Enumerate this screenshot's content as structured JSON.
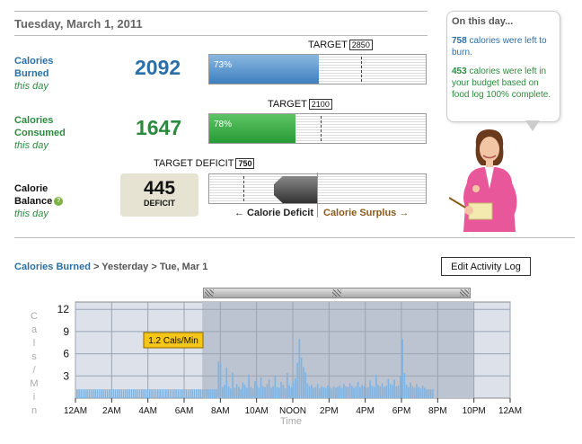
{
  "date": "Tuesday, March 1, 2011",
  "burned": {
    "label_line1": "Calories",
    "label_line2": "Burned",
    "sub": "this day",
    "value": "2092",
    "target_label": "TARGET",
    "target": "2850",
    "percent_label": "73%",
    "percent": 73
  },
  "consumed": {
    "label_line1": "Calories",
    "label_line2": "Consumed",
    "sub": "this day",
    "value": "1647",
    "target_label": "TARGET",
    "target": "2100",
    "percent_label": "78%",
    "percent": 78
  },
  "balance": {
    "label_line1": "Calorie",
    "label_line2": "Balance",
    "sub": "this day",
    "help_icon": "?",
    "value": "445",
    "value_label": "DEFICIT",
    "target_label": "TARGET DEFICIT",
    "target": "750",
    "left_label": "← Calorie Deficit",
    "right_label": "Calorie Surplus →"
  },
  "bubble": {
    "title": "On this day...",
    "line1_num": "758",
    "line1_text": " calories were left to burn.",
    "line2_num": "453",
    "line2_text": " calories were left in your budget based on food log 100% complete."
  },
  "breadcrumb": {
    "link": "Calories Burned",
    "rest": " > Yesterday > Tue, Mar 1"
  },
  "edit_button": "Edit Activity Log",
  "colors": {
    "blue": "#2a6fa8",
    "green": "#2b8a3e",
    "bar_blue": "#3d7fbf",
    "bar_green": "#279a35",
    "tooltip": "#f5c518"
  },
  "chart_data": {
    "type": "bar",
    "ylabel": "Cals/Min",
    "xlabel": "Time",
    "ylim": [
      0,
      13
    ],
    "yticks": [
      3,
      6,
      9,
      12
    ],
    "xticks": [
      "12AM",
      "2AM",
      "4AM",
      "6AM",
      "8AM",
      "10AM",
      "NOON",
      "2PM",
      "4PM",
      "6PM",
      "8PM",
      "10PM",
      "12AM"
    ],
    "tooltip": "1.2 Cals/Min",
    "grid": true,
    "series": [
      {
        "values": [
          1.2,
          1.2,
          1.2,
          1.2,
          1.2,
          1.2,
          1.2,
          1.2,
          1.2,
          1.2,
          1.2,
          1.2,
          1.2,
          1.2,
          1.2,
          1.2,
          1.2,
          1.2,
          1.2,
          1.2,
          1.2,
          1.2,
          1.2,
          1.2,
          1.2,
          1.2,
          1.2,
          1.2,
          1.2,
          1.2,
          1.2,
          1.2,
          1.2,
          1.2,
          1.2,
          1.2,
          1.2,
          1.2,
          1.2,
          1.2,
          1.2,
          1.2,
          1.2,
          1.2,
          1.2,
          1.2,
          1.2,
          1.2,
          1.2,
          1.2,
          1.2,
          1.2,
          1.2,
          1.2,
          1.2,
          1.2,
          1.2,
          1.2,
          1.2,
          1.2,
          1.2,
          1.2,
          1.2,
          1.2,
          1.2,
          1.2,
          1.2,
          1.2,
          1.2,
          1.2,
          5.0,
          4.6,
          1.5,
          1.8,
          4.1,
          1.6,
          1.3,
          3.5,
          1.4,
          1.9,
          1.5,
          1.2,
          2.1,
          1.8,
          1.4,
          3.2,
          1.5,
          1.3,
          2.3,
          1.7,
          1.4,
          2.8,
          1.6,
          1.5,
          1.9,
          2.5,
          1.4,
          1.6,
          3.0,
          1.5,
          1.4,
          2.2,
          1.8,
          1.3,
          3.4,
          1.7,
          1.5,
          2.1,
          2.7,
          4.8,
          8.0,
          5.5,
          4.2,
          3.5,
          2.0,
          1.6,
          1.8,
          1.4,
          1.5,
          1.9,
          1.3,
          1.6,
          1.5,
          1.4,
          1.7,
          1.5,
          1.3,
          1.6,
          1.4,
          1.5,
          1.7,
          1.4,
          1.9,
          1.6,
          1.5,
          2.0,
          1.7,
          1.4,
          1.6,
          2.2,
          1.5,
          1.8,
          1.6,
          1.4,
          1.5,
          2.4,
          1.7,
          1.5,
          3.2,
          1.8,
          1.6,
          2.0,
          1.5,
          1.7,
          2.6,
          1.9,
          1.8,
          2.5,
          1.6,
          1.7,
          3.0,
          8.0,
          3.4,
          1.8,
          1.5,
          2.1,
          1.6,
          1.4,
          1.9,
          1.5,
          1.3,
          1.7,
          1.4,
          1.2,
          1.2,
          1.2,
          1.2
        ]
      }
    ]
  }
}
